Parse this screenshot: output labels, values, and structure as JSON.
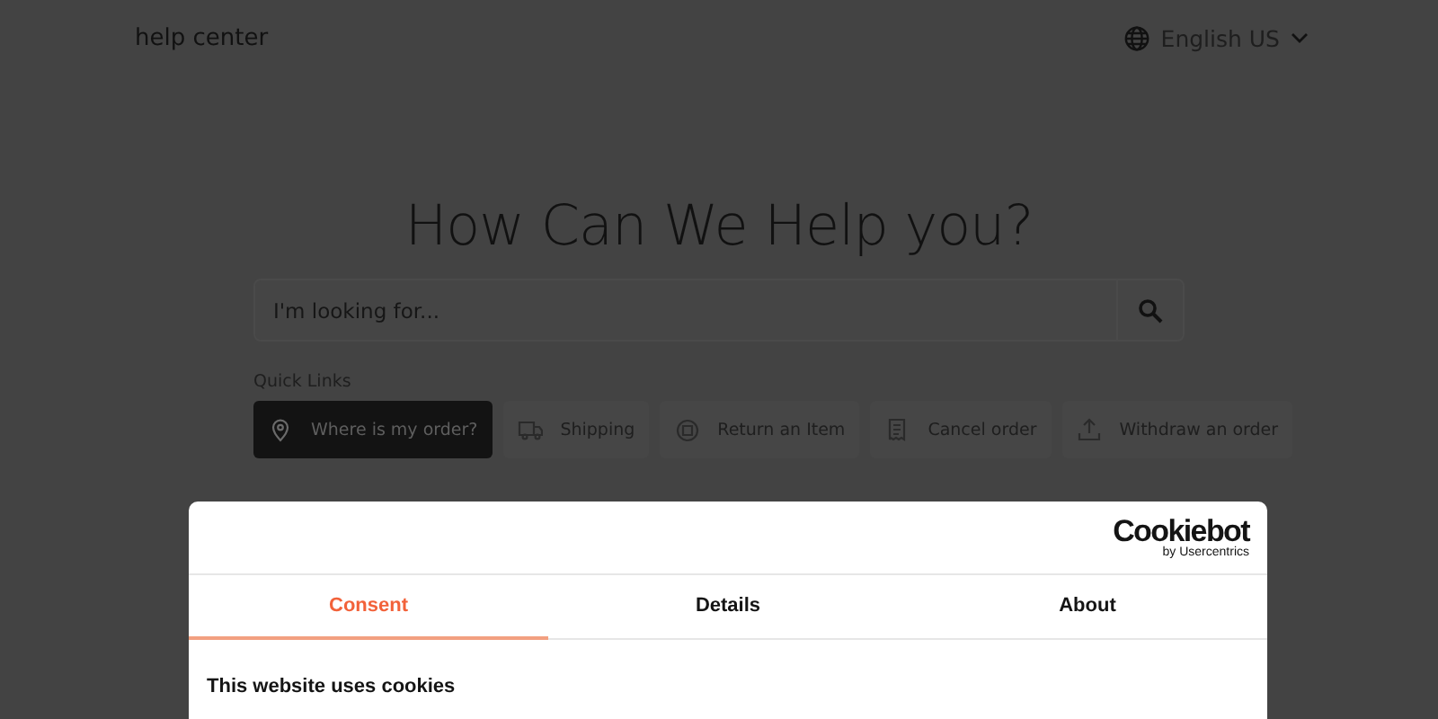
{
  "header": {
    "title": "help center",
    "language": "English US"
  },
  "hero": {
    "heading": "How Can We Help you?",
    "search": {
      "placeholder": "I'm looking for..."
    }
  },
  "quick_links": {
    "label": "Quick Links",
    "items": [
      {
        "label": "Where is my order?",
        "selected": true
      },
      {
        "label": "Shipping",
        "selected": false
      },
      {
        "label": "Return an Item",
        "selected": false
      },
      {
        "label": "Cancel order",
        "selected": false
      },
      {
        "label": "Withdraw an order",
        "selected": false
      }
    ]
  },
  "cookie_dialog": {
    "logo": {
      "name": "Cookiebot",
      "byline": "by Usercentrics"
    },
    "tabs": [
      {
        "label": "Consent",
        "selected": true
      },
      {
        "label": "Details",
        "selected": false
      },
      {
        "label": "About",
        "selected": false
      }
    ],
    "heading": "This website uses cookies"
  }
}
